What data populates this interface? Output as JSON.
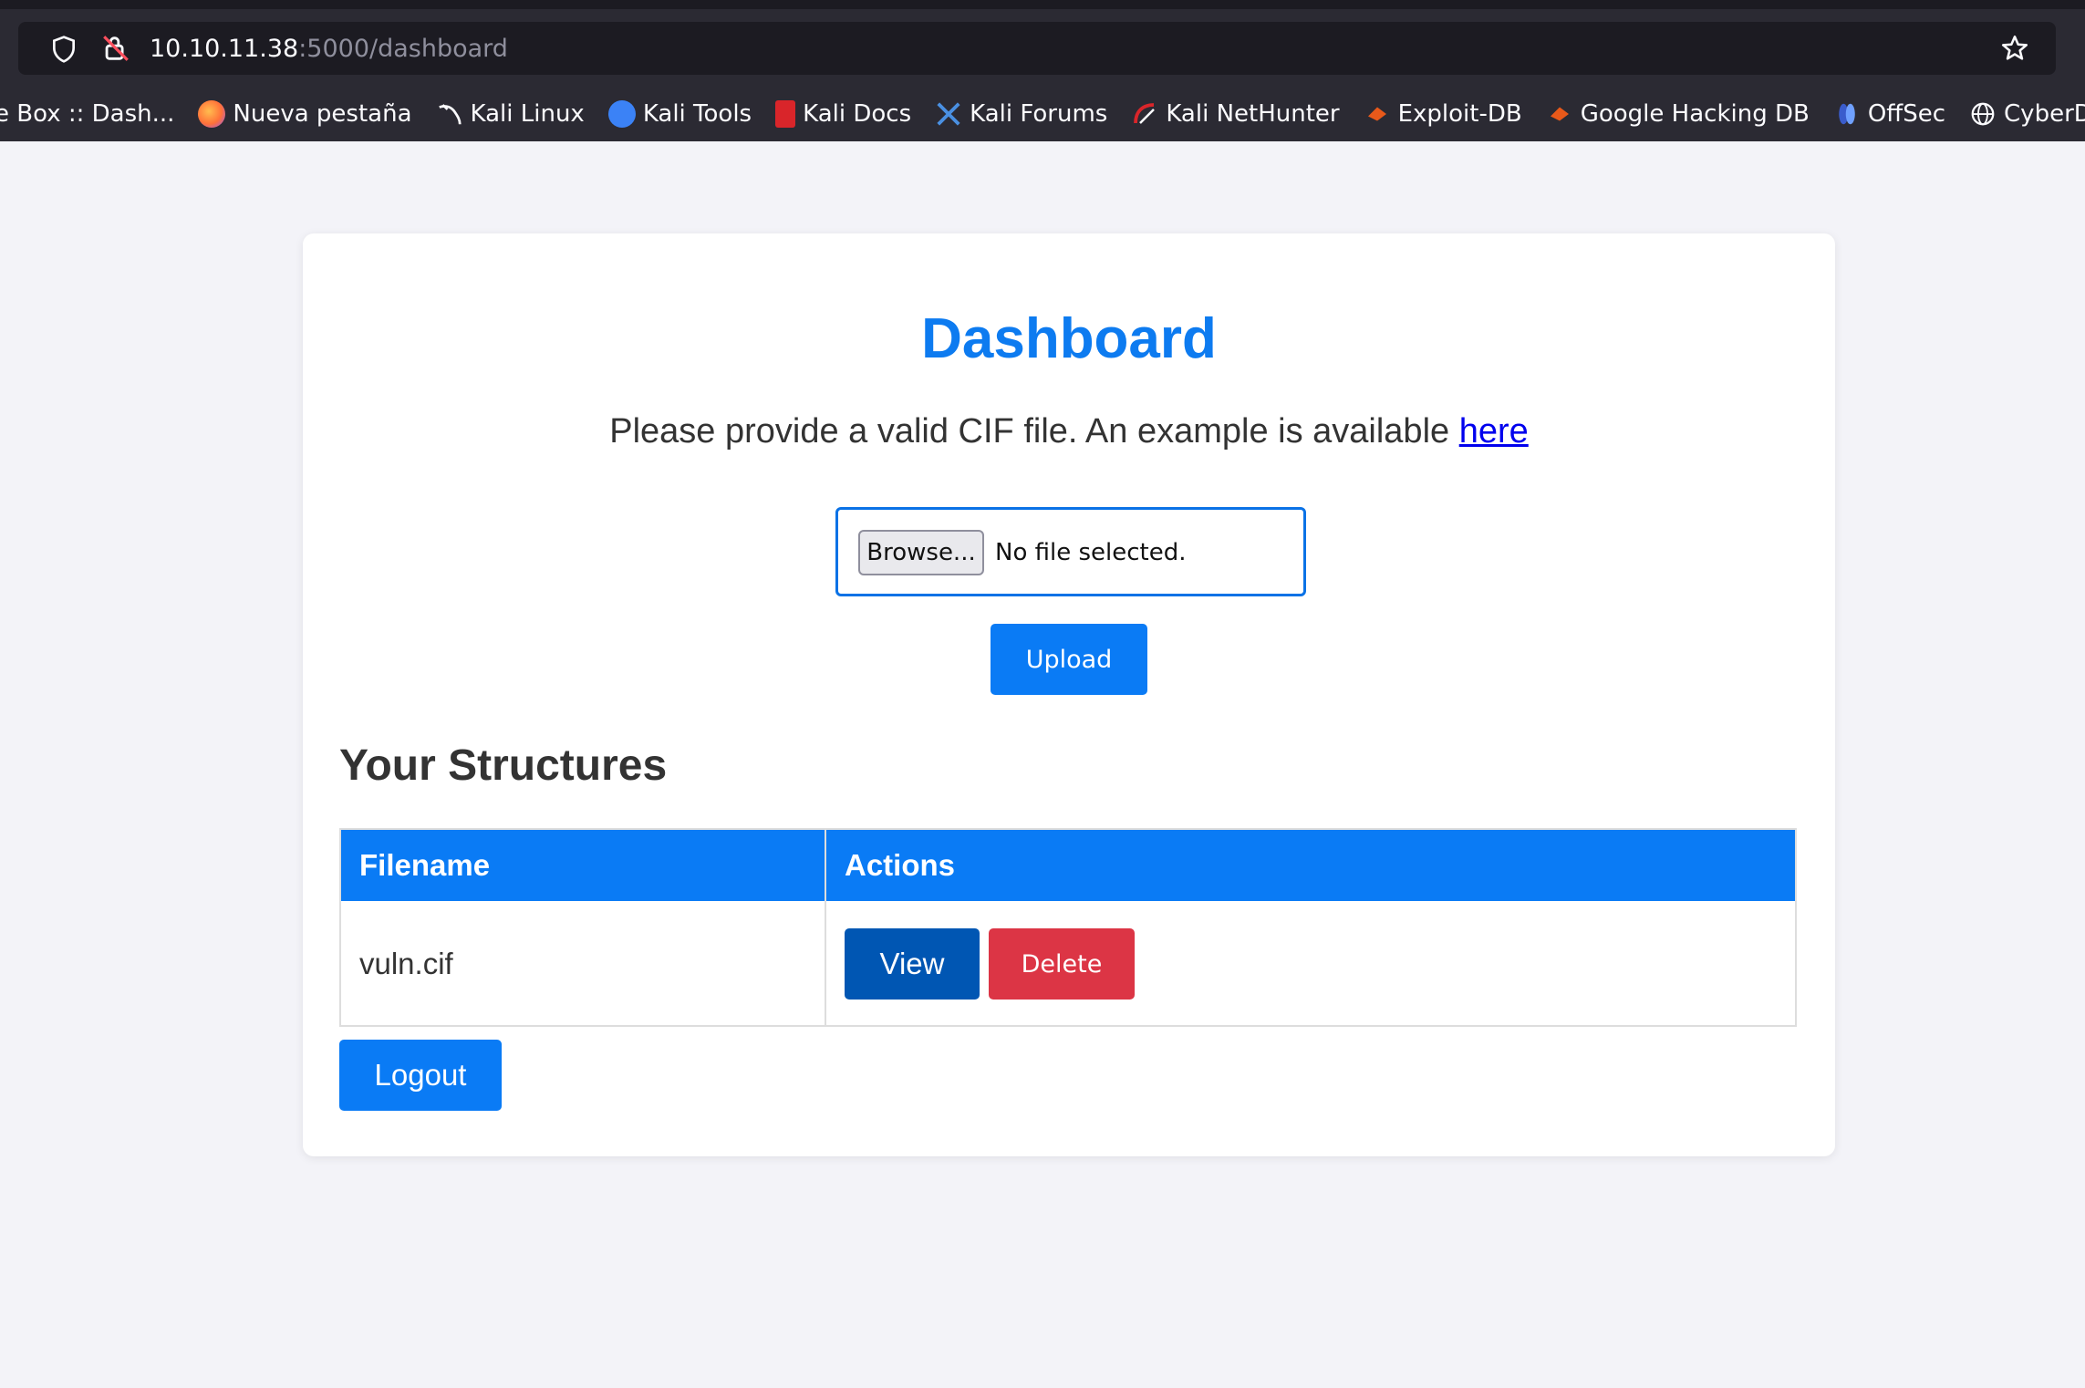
{
  "browser": {
    "url_host": "10.10.11.38",
    "url_path": ":5000/dashboard",
    "bookmarks": [
      {
        "label": "e Box :: Dash...",
        "icon": "htb-icon",
        "color": "#2b2a33"
      },
      {
        "label": "Nueva pestaña",
        "icon": "firefox-icon",
        "color": "#ff7139"
      },
      {
        "label": "Kali Linux",
        "icon": "kali-dragon-icon",
        "color": "#2b2a33"
      },
      {
        "label": "Kali Tools",
        "icon": "kali-tools-icon",
        "color": "#3b82f6"
      },
      {
        "label": "Kali Docs",
        "icon": "kali-docs-icon",
        "color": "#d9252a"
      },
      {
        "label": "Kali Forums",
        "icon": "kali-forums-icon",
        "color": "#4a90e2"
      },
      {
        "label": "Kali NetHunter",
        "icon": "nethunter-icon",
        "color": "#d9252a"
      },
      {
        "label": "Exploit-DB",
        "icon": "exploit-db-icon",
        "color": "#e8591a"
      },
      {
        "label": "Google Hacking DB",
        "icon": "ghdb-icon",
        "color": "#e8591a"
      },
      {
        "label": "OffSec",
        "icon": "offsec-icon",
        "color": "#3a5ccc"
      },
      {
        "label": "CyberDefe",
        "icon": "globe-icon",
        "color": "#2b2a33"
      }
    ]
  },
  "page": {
    "title": "Dashboard",
    "subtitle": "Please provide a valid CIF file. An example is available ",
    "subtitle_link": "here",
    "file_input": {
      "button_label": "Browse...",
      "status": "No file selected."
    },
    "upload_label": "Upload",
    "section_title": "Your Structures",
    "table": {
      "headers": [
        "Filename",
        "Actions"
      ],
      "rows": [
        {
          "filename": "vuln.cif",
          "view_label": "View",
          "delete_label": "Delete"
        }
      ]
    },
    "logout_label": "Logout"
  },
  "colors": {
    "accent": "#0a7bf5",
    "view": "#0056b3",
    "danger": "#dc3545",
    "title": "#0d7bf0"
  }
}
